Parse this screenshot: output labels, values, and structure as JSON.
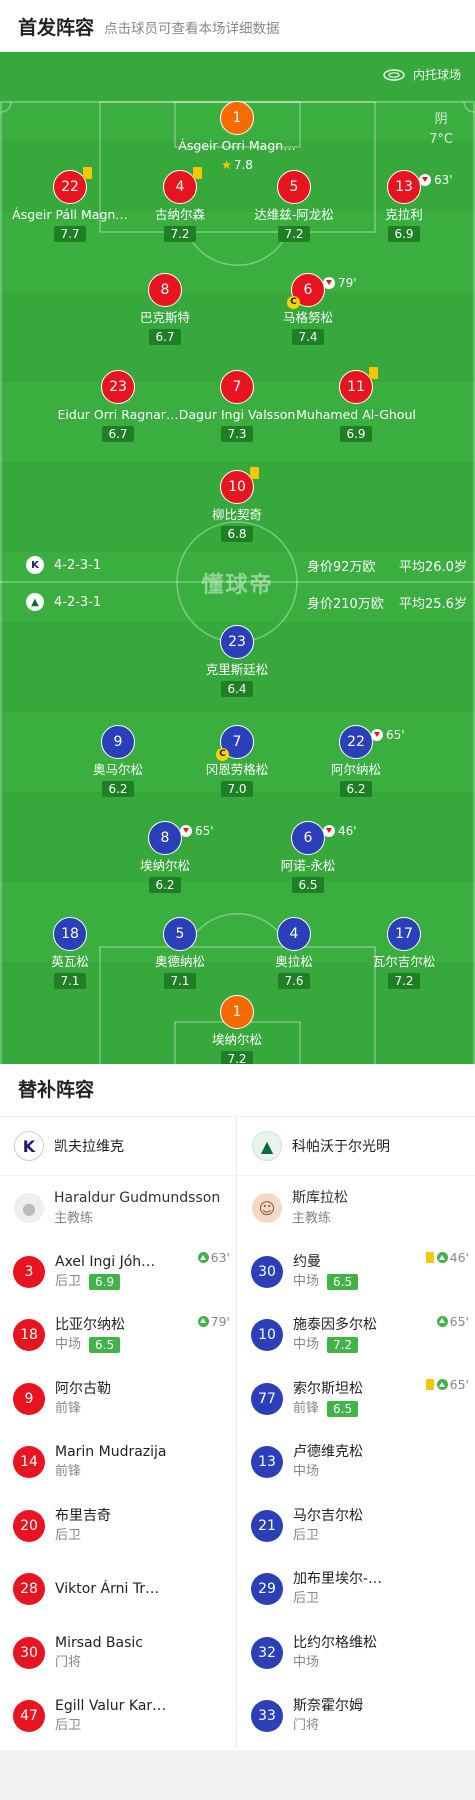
{
  "header": {
    "title": "首发阵容",
    "subtitle": "点击球员可查看本场详细数据"
  },
  "pitch": {
    "venue": "内托球场",
    "weather": {
      "condition": "阴",
      "temp": "7°C"
    },
    "watermark": "懂球帝",
    "home_team": {
      "formation": "4-2-3-1",
      "value": "身价92万欧",
      "age": "平均26.0岁"
    },
    "away_team": {
      "formation": "4-2-3-1",
      "value": "身价210万欧",
      "age": "平均25.6岁"
    },
    "home_players": [
      {
        "num": "1",
        "name": "Ásgeir Orri Magn…",
        "rating": "7.8",
        "star": true,
        "gk": true
      },
      {
        "num": "22",
        "name": "Ásgeir Páll Magn…",
        "rating": "7.7",
        "yellow": true
      },
      {
        "num": "4",
        "name": "古纳尔森",
        "rating": "7.2",
        "yellow": true
      },
      {
        "num": "5",
        "name": "达维兹-阿龙松",
        "rating": "7.2"
      },
      {
        "num": "13",
        "name": "克拉利",
        "rating": "6.9",
        "sub_out": "63'"
      },
      {
        "num": "8",
        "name": "巴克斯特",
        "rating": "6.7"
      },
      {
        "num": "6",
        "name": "马格努松",
        "rating": "7.4",
        "sub_out": "79'",
        "captain": true
      },
      {
        "num": "23",
        "name": "Eidur Orri Ragnar…",
        "rating": "6.7"
      },
      {
        "num": "7",
        "name": "Dagur Ingi Valsson",
        "rating": "7.3"
      },
      {
        "num": "11",
        "name": "Muhamed Al-Ghoul",
        "rating": "6.9",
        "yellow": true
      },
      {
        "num": "10",
        "name": "柳比契奇",
        "rating": "6.8",
        "yellow": true
      }
    ],
    "away_players": [
      {
        "num": "23",
        "name": "克里斯廷松",
        "rating": "6.4"
      },
      {
        "num": "9",
        "name": "奥马尔松",
        "rating": "6.2"
      },
      {
        "num": "7",
        "name": "冈恩劳格松",
        "rating": "7.0",
        "captain": true
      },
      {
        "num": "22",
        "name": "阿尔纳松",
        "rating": "6.2",
        "sub_out": "65'"
      },
      {
        "num": "8",
        "name": "埃纳尔松",
        "rating": "6.2",
        "sub_out": "65'"
      },
      {
        "num": "6",
        "name": "阿诺-永松",
        "rating": "6.5",
        "sub_out": "46'"
      },
      {
        "num": "18",
        "name": "英瓦松",
        "rating": "7.1"
      },
      {
        "num": "5",
        "name": "奥德纳松",
        "rating": "7.1"
      },
      {
        "num": "4",
        "name": "奥拉松",
        "rating": "7.6"
      },
      {
        "num": "17",
        "name": "瓦尔吉尔松",
        "rating": "7.2"
      },
      {
        "num": "1",
        "name": "埃纳尔松",
        "rating": "7.2",
        "gk": true
      }
    ]
  },
  "subs": {
    "title": "替补阵容",
    "home": {
      "team": "凯夫拉维克",
      "coach": {
        "name": "Haraldur Gudmundsson",
        "role": "主教练"
      },
      "players": [
        {
          "num": "3",
          "name": "Axel Ingi Jóh…",
          "pos": "后卫",
          "rating": "6.9",
          "in": "63'"
        },
        {
          "num": "18",
          "name": "比亚尔纳松",
          "pos": "中场",
          "rating": "6.5",
          "in": "79'"
        },
        {
          "num": "9",
          "name": "阿尔古勒",
          "pos": "前锋"
        },
        {
          "num": "14",
          "name": "Marin Mudrazija",
          "pos": "前锋"
        },
        {
          "num": "20",
          "name": "布里吉奇",
          "pos": "后卫"
        },
        {
          "num": "28",
          "name": "Viktor Árni Tr…",
          "pos": ""
        },
        {
          "num": "30",
          "name": "Mirsad Basic",
          "pos": "门将"
        },
        {
          "num": "47",
          "name": "Egill Valur Kar…",
          "pos": "后卫"
        }
      ]
    },
    "away": {
      "team": "科帕沃于尔光明",
      "coach": {
        "name": "斯库拉松",
        "role": "主教练"
      },
      "players": [
        {
          "num": "30",
          "name": "约曼",
          "pos": "中场",
          "rating": "6.5",
          "in": "46'",
          "yellow": true
        },
        {
          "num": "10",
          "name": "施泰因多尔松",
          "pos": "中场",
          "rating": "7.2",
          "in": "65'"
        },
        {
          "num": "77",
          "name": "索尔斯坦松",
          "pos": "前锋",
          "rating": "6.5",
          "in": "65'",
          "yellow": true
        },
        {
          "num": "13",
          "name": "卢德维克松",
          "pos": "中场"
        },
        {
          "num": "21",
          "name": "马尔吉尔松",
          "pos": "后卫"
        },
        {
          "num": "29",
          "name": "加布里埃尔-…",
          "pos": "后卫"
        },
        {
          "num": "32",
          "name": "比约尔格维松",
          "pos": "中场"
        },
        {
          "num": "33",
          "name": "斯奈霍尔姆",
          "pos": "门将"
        }
      ]
    }
  }
}
